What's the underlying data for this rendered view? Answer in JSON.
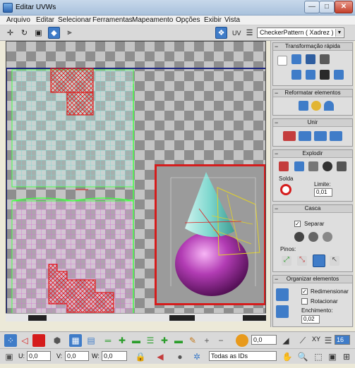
{
  "window": {
    "title": "Editar UVWs",
    "min": "—",
    "max": "□",
    "close": "✕"
  },
  "menu": [
    "Arquivo",
    "Editar",
    "Selecionar",
    "Ferramentas",
    "Mapeamento",
    "Opções",
    "Exibir",
    "Vista"
  ],
  "toolbar": {
    "uv_label": "UV",
    "texture_select": "CheckerPattern  ( Xadrez )"
  },
  "panel": {
    "quick_transform": "Transformação rápida",
    "reshape": "Reformatar elementos",
    "stitch": "Unir",
    "explode": "Explodir",
    "weld": "Solda",
    "limit_label": "Limite:",
    "limit_value": "0,01",
    "peel": "Casca",
    "detach": "Separar",
    "pins": "Pinos:",
    "arrange": "Organizar elementos",
    "rescale": "Redimensionar",
    "rotate": "Rotacionar",
    "padding_label": "Enchimento:",
    "padding_value": "0,02"
  },
  "bottom": {
    "num_field": "0,0",
    "xy_label": "XY",
    "snap_value": "16",
    "u_label": "U:",
    "u_value": "0,0",
    "v_label": "V:",
    "v_value": "0,0",
    "w_label": "W:",
    "w_value": "0,0",
    "id_select": "Todas as IDs"
  },
  "colors": {
    "selection": "#e11d1d",
    "accent": "#3f7cc8",
    "uv_edge": "#33ff33",
    "cone": "#7fd8cf",
    "sphere": "#b23cb4"
  }
}
